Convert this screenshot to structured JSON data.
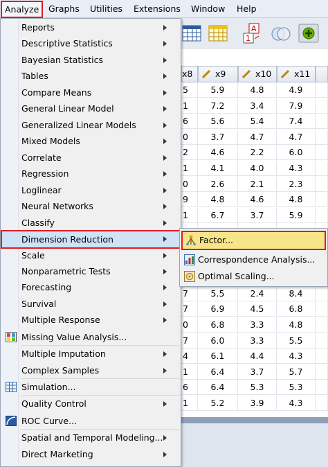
{
  "menubar": {
    "items": [
      "Analyze",
      "Graphs",
      "Utilities",
      "Extensions",
      "Window",
      "Help"
    ]
  },
  "grid": {
    "columns": [
      "x8",
      "x9",
      "x10",
      "x11"
    ],
    "rows": [
      [
        "5",
        "5.9",
        "4.8",
        "4.9"
      ],
      [
        "1",
        "7.2",
        "3.4",
        "7.9"
      ],
      [
        "6",
        "5.6",
        "5.4",
        "7.4"
      ],
      [
        "0",
        "3.7",
        "4.7",
        "4.7"
      ],
      [
        "2",
        "4.6",
        "2.2",
        "6.0"
      ],
      [
        "1",
        "4.1",
        "4.0",
        "4.3"
      ],
      [
        "0",
        "2.6",
        "2.1",
        "2.3"
      ],
      [
        "9",
        "4.8",
        "4.6",
        "4.8"
      ],
      [
        "1",
        "6.7",
        "3.7",
        "5.9"
      ],
      [
        "",
        "",
        "",
        ""
      ],
      [
        "",
        "",
        "",
        ""
      ],
      [
        "",
        "",
        "",
        ""
      ],
      [
        "",
        "",
        "",
        ""
      ],
      [
        "7",
        "5.5",
        "2.4",
        "8.4"
      ],
      [
        "7",
        "6.9",
        "4.5",
        "6.8"
      ],
      [
        "0",
        "6.8",
        "3.3",
        "4.8"
      ],
      [
        "7",
        "6.0",
        "3.3",
        "5.5"
      ],
      [
        "4",
        "6.1",
        "4.4",
        "4.3"
      ],
      [
        "1",
        "6.4",
        "3.7",
        "5.7"
      ],
      [
        "6",
        "6.4",
        "5.3",
        "5.3"
      ],
      [
        "1",
        "5.2",
        "3.9",
        "4.3"
      ]
    ]
  },
  "menu": {
    "items": [
      "Reports",
      "Descriptive Statistics",
      "Bayesian Statistics",
      "Tables",
      "Compare Means",
      "General Linear Model",
      "Generalized Linear Models",
      "Mixed Models",
      "Correlate",
      "Regression",
      "Loglinear",
      "Neural Networks",
      "Classify",
      "Dimension Reduction",
      "Scale",
      "Nonparametric Tests",
      "Forecasting",
      "Survival",
      "Multiple Response",
      "Missing Value Analysis...",
      "Multiple Imputation",
      "Complex Samples",
      "Simulation...",
      "Quality Control",
      "ROC Curve...",
      "Spatial and Temporal Modeling...",
      "Direct Marketing"
    ]
  },
  "submenu": {
    "items": [
      "Factor...",
      "Correspondence Analysis...",
      "Optimal Scaling..."
    ]
  },
  "colors": {
    "highlight_border": "#e11b22",
    "selected_row": "#cfe2f6",
    "submenu_selected": "#f7e58a"
  }
}
